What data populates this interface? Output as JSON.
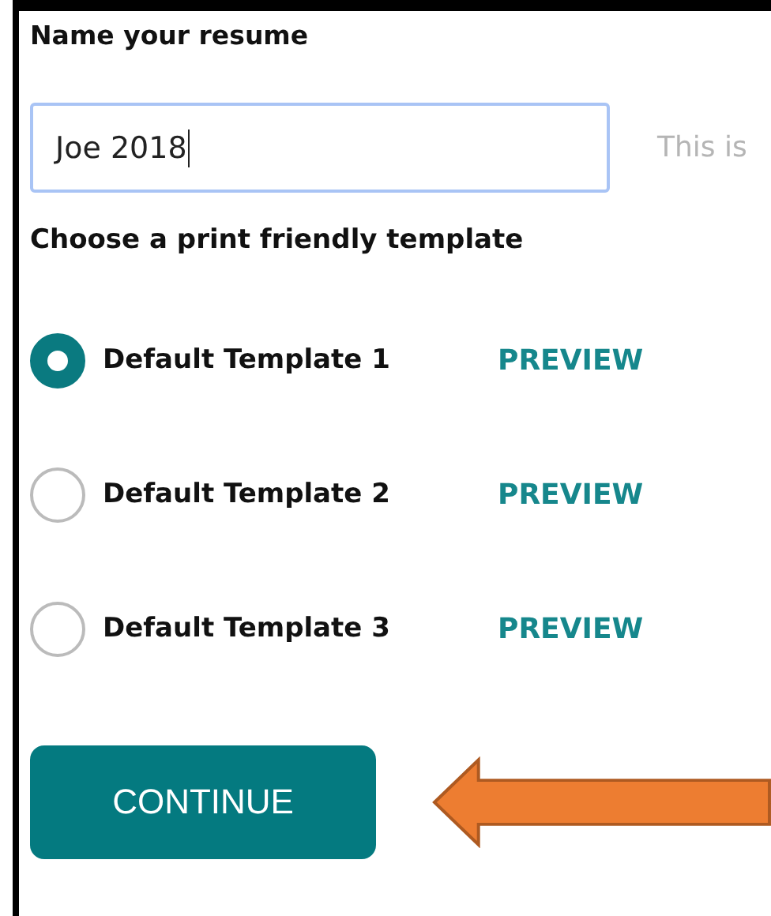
{
  "title": "Name your resume",
  "name_field": {
    "value": "Joe 2018",
    "side_text": "This is"
  },
  "template_heading": "Choose a print friendly template",
  "templates": [
    {
      "label": "Default Template 1",
      "selected": true,
      "preview": "PREVIEW"
    },
    {
      "label": "Default Template 2",
      "selected": false,
      "preview": "PREVIEW"
    },
    {
      "label": "Default Template 3",
      "selected": false,
      "preview": "PREVIEW"
    }
  ],
  "continue_button": "CONTINUE"
}
